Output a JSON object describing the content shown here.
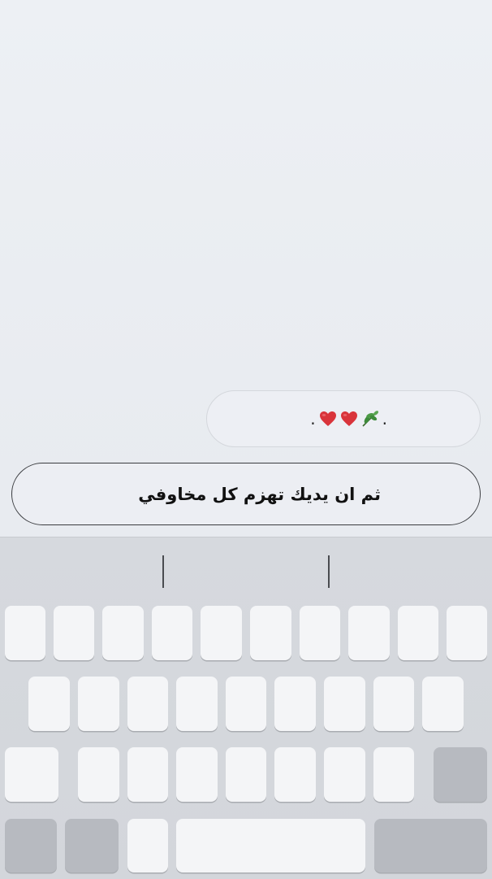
{
  "chat": {
    "emoji_message": {
      "dot_left": ".",
      "icons": [
        "leaf-icon",
        "heart-icon",
        "heart-icon"
      ],
      "dot_right": "."
    },
    "text_message": "ثم ان يديك تهزم كل مخاوفي"
  },
  "keyboard": {
    "suggestions": [
      "",
      "",
      ""
    ],
    "rows": [
      10,
      9,
      9,
      4
    ]
  },
  "colors": {
    "heart": "#d9343b",
    "leaf": "#3d8b3a",
    "key": "#f4f5f7",
    "key_dark": "#b7bac0"
  }
}
